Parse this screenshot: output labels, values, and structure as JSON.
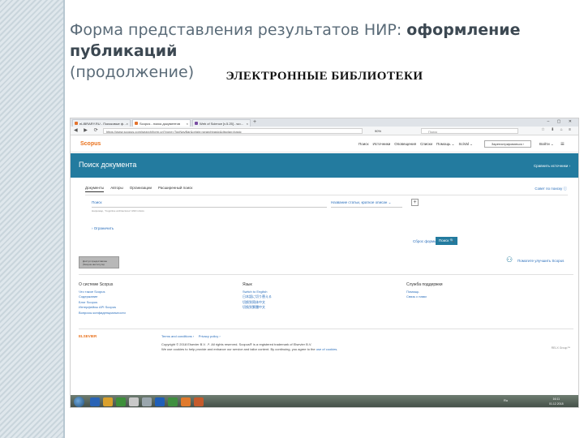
{
  "slide": {
    "title_main": "Форма представления результатов НИР: ",
    "title_bold": "оформление публикаций",
    "title_tail": "(продолжение)",
    "subtitle": "ЭЛЕКТРОННЫЕ БИБЛИОТЕКИ"
  },
  "browser": {
    "tabs": [
      {
        "label": "eLIBRARY.RU - Поисковые ф…"
      },
      {
        "label": "Scopus - поиск документов"
      },
      {
        "label": "Web of Science [v.5.25] - wo…"
      }
    ],
    "new_tab": "+",
    "url": "https://www.scopus.com/search/form.uri?zone=TopNavBar&origin=searchbasic&display=basic",
    "zoom": "90%",
    "search_placeholder": "Поиск"
  },
  "nav": {
    "logo": "Scopus",
    "links": [
      "Поиск",
      "Источники",
      "Оповещения",
      "Списки",
      "Помощь ⌄",
      "SciVal ⌄"
    ],
    "register": "Зарегистрироваться ›",
    "login": "Войти ⌄"
  },
  "hero": {
    "title": "Поиск документа",
    "compare": "Сравнить источники ›"
  },
  "search": {
    "tabs": [
      "Документы",
      "Авторы",
      "Организации",
      "Расширенный поиск"
    ],
    "history": "Совет по поиску ⓘ",
    "label": "Поиск",
    "example": "Например, \"Cognitive architectures\" AND robots",
    "field": "Название статьи, краткое описан ⌄",
    "add": "+",
    "limit": "› Ограничить",
    "reset": "Сброс формы",
    "button": "Поиск 🔍"
  },
  "promo": "Доступ предоставлен\n(Scopus института)",
  "improve": "Помогите улучшить Scopus",
  "footer": {
    "columns": [
      {
        "heading": "О системе Scopus",
        "links": [
          "Что такое Scopus",
          "Содержание",
          "Блог Scopus",
          "Интерфейсы API Scopus",
          "Вопросы конфиденциальности"
        ]
      },
      {
        "heading": "Язык",
        "links": [
          "Switch to English",
          "日本語に切り替える",
          "切换到简体中文",
          "切換到繁體中文"
        ]
      },
      {
        "heading": "Служба поддержки",
        "links": [
          "Помощь",
          "Связь с нами"
        ]
      }
    ],
    "elsevier": "ELSEVIER",
    "legal": "Terms and conditions ›     Privacy policy ›",
    "copyright": "Copyright © 2018 Elsevier B.V. ↗. All rights reserved. Scopus® is a registered trademark of Elsevier B.V.",
    "cookies_pre": "We use cookies to help provide and enhance our service and tailor content. By continuing, you agree to the ",
    "cookies_link": "use of cookies",
    "relx": "RELX Group™"
  },
  "taskbar": {
    "lang": "Ru",
    "time": "16:11",
    "date": "01.12.2018"
  }
}
